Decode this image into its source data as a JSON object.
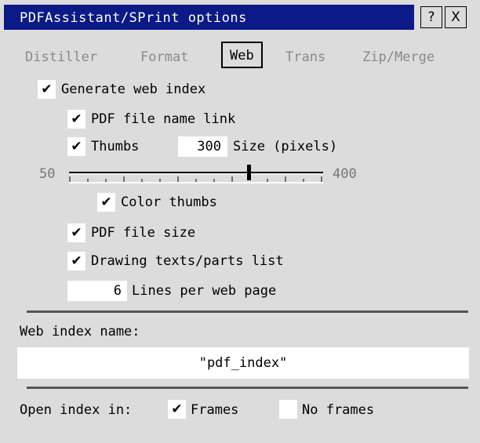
{
  "window": {
    "title": "PDFAssistant/SPrint options",
    "help_button": "?",
    "close_button": "X"
  },
  "tabs": [
    {
      "label": "Distiller",
      "active": false
    },
    {
      "label": "Format",
      "active": false
    },
    {
      "label": "Web",
      "active": true
    },
    {
      "label": "Trans",
      "active": false
    },
    {
      "label": "Zip/Merge",
      "active": false
    }
  ],
  "options": {
    "generate_web_index": {
      "label": "Generate web index",
      "checked": true
    },
    "pdf_file_name_link": {
      "label": "PDF file name link",
      "checked": true
    },
    "thumbs": {
      "label": "Thumbs",
      "checked": true,
      "size_value": "300",
      "size_label": "Size (pixels)"
    },
    "slider": {
      "min_label": "50",
      "max_label": "400",
      "value": 300
    },
    "color_thumbs": {
      "label": "Color thumbs",
      "checked": true
    },
    "pdf_file_size": {
      "label": "PDF file size",
      "checked": true
    },
    "drawing_texts": {
      "label": "Drawing texts/parts list",
      "checked": true
    },
    "lines_per_page": {
      "value": "6",
      "label": "Lines per web page"
    }
  },
  "web_index_name": {
    "label": "Web index name:",
    "value": "\"pdf_index\""
  },
  "open_index": {
    "label": "Open index in:",
    "frames": {
      "label": "Frames",
      "checked": true
    },
    "no_frames": {
      "label": "No frames",
      "checked": false
    }
  },
  "check_glyph": "✔"
}
